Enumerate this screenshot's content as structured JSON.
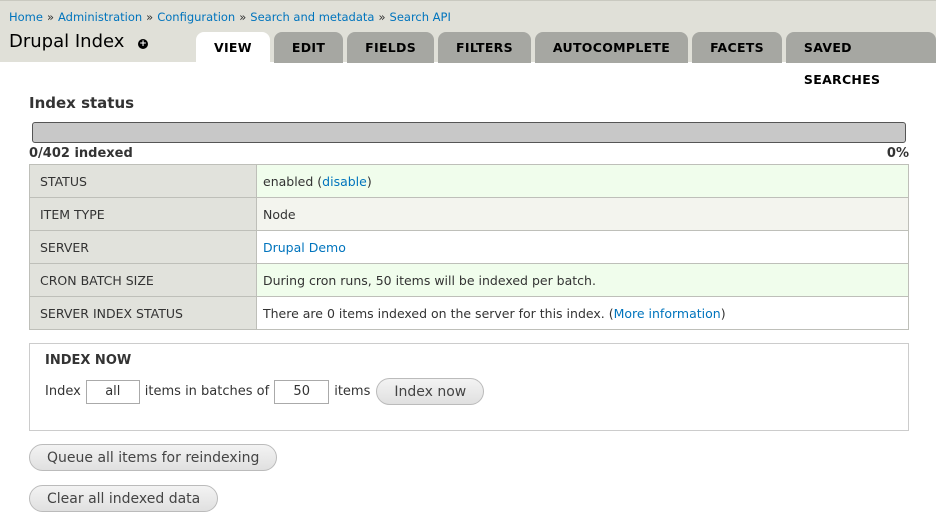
{
  "breadcrumb": [
    {
      "label": "Home"
    },
    {
      "label": "Administration"
    },
    {
      "label": "Configuration"
    },
    {
      "label": "Search and metadata"
    },
    {
      "label": "Search API"
    }
  ],
  "breadcrumb_sep": "»",
  "page_title": "Drupal Index",
  "tabs": [
    {
      "label": "VIEW",
      "active": true
    },
    {
      "label": "EDIT"
    },
    {
      "label": "FIELDS"
    },
    {
      "label": "FILTERS"
    },
    {
      "label": "AUTOCOMPLETE"
    },
    {
      "label": "FACETS"
    },
    {
      "label": "SAVED SEARCHES"
    }
  ],
  "index_status": {
    "title": "Index status",
    "progress_fraction": 0,
    "progress_text": "0/402 indexed",
    "progress_percent": "0%"
  },
  "status_rows": {
    "status": {
      "label": "STATUS",
      "value_prefix": "enabled (",
      "link": "disable",
      "value_suffix": ")"
    },
    "item_type": {
      "label": "ITEM TYPE",
      "value": "Node"
    },
    "server": {
      "label": "SERVER",
      "link": "Drupal Demo"
    },
    "cron": {
      "label": "CRON BATCH SIZE",
      "value": "During cron runs, 50 items will be indexed per batch."
    },
    "server_status": {
      "label": "SERVER INDEX STATUS",
      "value_prefix": "There are 0 items indexed on the server for this index. (",
      "link": "More information",
      "value_suffix": ")"
    }
  },
  "index_now": {
    "title": "INDEX NOW",
    "label_index": "Index",
    "limit_value": "all",
    "label_batches": "items in batches of",
    "batch_value": "50",
    "label_items": "items",
    "button": "Index now"
  },
  "actions": {
    "queue_label": "Queue all items for reindexing",
    "clear_label": "Clear all indexed data"
  },
  "colors": {
    "link": "#0074bd",
    "header_bg": "#e0e0d8",
    "tab_bg": "#a6a7a2",
    "status_ok_bg": "#f0fdec"
  }
}
